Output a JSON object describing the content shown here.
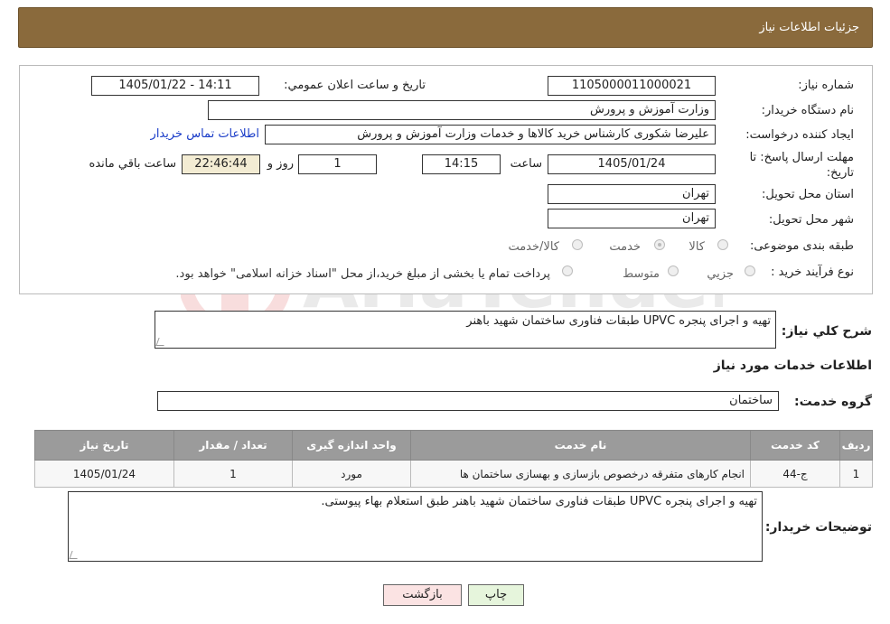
{
  "header": {
    "title": "جزئیات اطلاعات نیاز"
  },
  "form": {
    "need_number_label": "شماره نیاز:",
    "need_number": "1105000011000021",
    "announce_label": "تاریخ و ساعت اعلان عمومي:",
    "announce_value": "1405/01/22 - 14:11",
    "buyer_org_label": "نام دستگاه خريدار:",
    "buyer_org": "وزارت آموزش و پرورش",
    "creator_label": "ايجاد کننده درخواست:",
    "creator": "عليرضا شکوری کارشناس خريد کالاها و خدمات وزارت آموزش و پرورش",
    "contact_link": "اطلاعات تماس خريدار",
    "deadline_label": "مهلت ارسال پاسخ: تا تاريخ:",
    "deadline_date": "1405/01/24",
    "time_label": "ساعت",
    "deadline_time": "14:15",
    "days": "1",
    "days_label": "روز و",
    "remaining": "22:46:44",
    "remaining_label": "ساعت باقي مانده",
    "province_label": "استان محل تحويل:",
    "province": "تهران",
    "city_label": "شهر محل تحويل:",
    "city": "تهران",
    "category_label": "طبقه بندی موضوعی:",
    "category_options": [
      "کالا",
      "خدمت",
      "کالا/خدمت"
    ],
    "category_selected": "خدمت",
    "process_label": "نوع فرآيند خريد :",
    "process_options": [
      "جزيي",
      "متوسط"
    ],
    "process_note": "پرداخت تمام يا بخشی از مبلغ خريد،از محل \"اسناد خزانه اسلامی\" خواهد بود."
  },
  "summary": {
    "label": "شرح کلي نياز:",
    "text": "تهيه و اجرای پنجره UPVC طبقات فناوری ساختمان شهيد باهنر"
  },
  "services": {
    "section_title": "اطلاعات خدمات مورد نياز",
    "group_label": "گروه خدمت:",
    "group_value": "ساختمان",
    "columns": [
      "رديف",
      "کد خدمت",
      "نام خدمت",
      "واحد اندازه گيری",
      "تعداد / مقدار",
      "تاريخ نياز"
    ],
    "rows": [
      [
        "1",
        "ج-44",
        "انجام کارهای متفرقه درخصوص بازسازی و بهسازی ساختمان ها",
        "مورد",
        "1",
        "1405/01/24"
      ]
    ]
  },
  "buyer_notes": {
    "label": "توضيحات خريدار:",
    "text": "تهيه و اجرای پنجره UPVC طبقات فناوری ساختمان شهيد باهنر طبق استعلام بهاء پيوستی."
  },
  "buttons": {
    "print": "چاپ",
    "back": "بازگشت"
  },
  "colors": {
    "header_bg": "#8a6a3c",
    "remaining_bg": "#f3ecd3",
    "print_bg": "#e6f5dc",
    "back_bg": "#fbe3e3",
    "table_header_bg": "#9b9b9b"
  }
}
